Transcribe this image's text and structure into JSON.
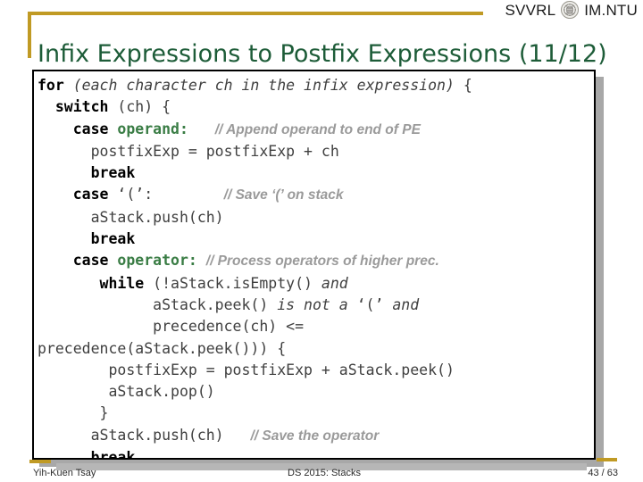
{
  "brand": {
    "left_text": "SVVRL",
    "right_text": "IM.NTU",
    "logo_name": "ntu-seal-icon"
  },
  "title": "Infix Expressions to Postfix Expressions (11/12)",
  "colors": {
    "title_green": "#1d5c38",
    "accent_gold": "#c09a24",
    "keyword_black": "#000000",
    "identifier_green": "#3a7d45",
    "comment_gray": "#9a9a9a",
    "code_text": "#3f3f3f",
    "footer_bar_gray": "#b6b6b6",
    "shadow_gray": "#a8a8a8"
  },
  "code": {
    "language": "pseudocode",
    "lines": [
      {
        "id": 1,
        "indent": 0,
        "segments": [
          {
            "text": "for ",
            "style": "kw"
          },
          {
            "text": "(each character ch in the infix expression)",
            "style": "ital"
          },
          {
            "text": " {",
            "style": "plain"
          }
        ]
      },
      {
        "id": 2,
        "indent": 2,
        "segments": [
          {
            "text": "switch ",
            "style": "kw"
          },
          {
            "text": "(ch) {",
            "style": "plain"
          }
        ]
      },
      {
        "id": 3,
        "indent": 4,
        "segments": [
          {
            "text": "case ",
            "style": "kw"
          },
          {
            "text": "operand:",
            "style": "grn"
          },
          {
            "text": "   ",
            "style": "plain"
          },
          {
            "text": "// Append operand to end of PE",
            "style": "cmt"
          }
        ]
      },
      {
        "id": 4,
        "indent": 6,
        "segments": [
          {
            "text": "postfixExp = postfixExp + ch",
            "style": "plain"
          }
        ]
      },
      {
        "id": 5,
        "indent": 6,
        "segments": [
          {
            "text": "break",
            "style": "kw"
          }
        ]
      },
      {
        "id": 6,
        "indent": 4,
        "segments": [
          {
            "text": "case ",
            "style": "kw"
          },
          {
            "text": "‘(’:",
            "style": "plain"
          },
          {
            "text": "        ",
            "style": "plain"
          },
          {
            "text": "// Save ‘(’ on stack",
            "style": "cmt"
          }
        ]
      },
      {
        "id": 7,
        "indent": 6,
        "segments": [
          {
            "text": "aStack.push(ch)",
            "style": "plain"
          }
        ]
      },
      {
        "id": 8,
        "indent": 6,
        "segments": [
          {
            "text": "break",
            "style": "kw"
          }
        ]
      },
      {
        "id": 9,
        "indent": 4,
        "segments": [
          {
            "text": "case ",
            "style": "kw"
          },
          {
            "text": "operator:",
            "style": "grn"
          },
          {
            "text": " ",
            "style": "plain"
          },
          {
            "text": "// Process operators of higher prec.",
            "style": "cmt"
          }
        ]
      },
      {
        "id": 10,
        "indent": 7,
        "segments": [
          {
            "text": "while ",
            "style": "kw"
          },
          {
            "text": "(!aStack.isEmpty() ",
            "style": "plain"
          },
          {
            "text": "and",
            "style": "ital"
          }
        ]
      },
      {
        "id": 11,
        "indent": 13,
        "segments": [
          {
            "text": "aStack.peek() ",
            "style": "plain"
          },
          {
            "text": "is not a ",
            "style": "ital"
          },
          {
            "text": "‘(’ ",
            "style": "plain"
          },
          {
            "text": "and",
            "style": "ital"
          }
        ]
      },
      {
        "id": 12,
        "indent": 13,
        "segments": [
          {
            "text": "precedence(ch) <=",
            "style": "plain"
          }
        ]
      },
      {
        "id": 13,
        "indent": 0,
        "segments": [
          {
            "text": "precedence(aStack.peek())) {",
            "style": "plain"
          }
        ]
      },
      {
        "id": 14,
        "indent": 8,
        "segments": [
          {
            "text": "postfixExp = postfixExp + aStack.peek()",
            "style": "plain"
          }
        ]
      },
      {
        "id": 15,
        "indent": 8,
        "segments": [
          {
            "text": "aStack.pop()",
            "style": "plain"
          }
        ]
      },
      {
        "id": 16,
        "indent": 7,
        "segments": [
          {
            "text": "}",
            "style": "plain"
          }
        ]
      },
      {
        "id": 17,
        "indent": 6,
        "segments": [
          {
            "text": "aStack.push(ch)",
            "style": "plain"
          },
          {
            "text": "   ",
            "style": "plain"
          },
          {
            "text": "// Save the operator",
            "style": "cmt"
          }
        ]
      },
      {
        "id": 18,
        "indent": 6,
        "segments": [
          {
            "text": "break",
            "style": "kw"
          }
        ]
      }
    ]
  },
  "footer": {
    "author": "Yih-Kuen Tsay",
    "course": "DS 2015: Stacks",
    "page": "43 / 63"
  }
}
